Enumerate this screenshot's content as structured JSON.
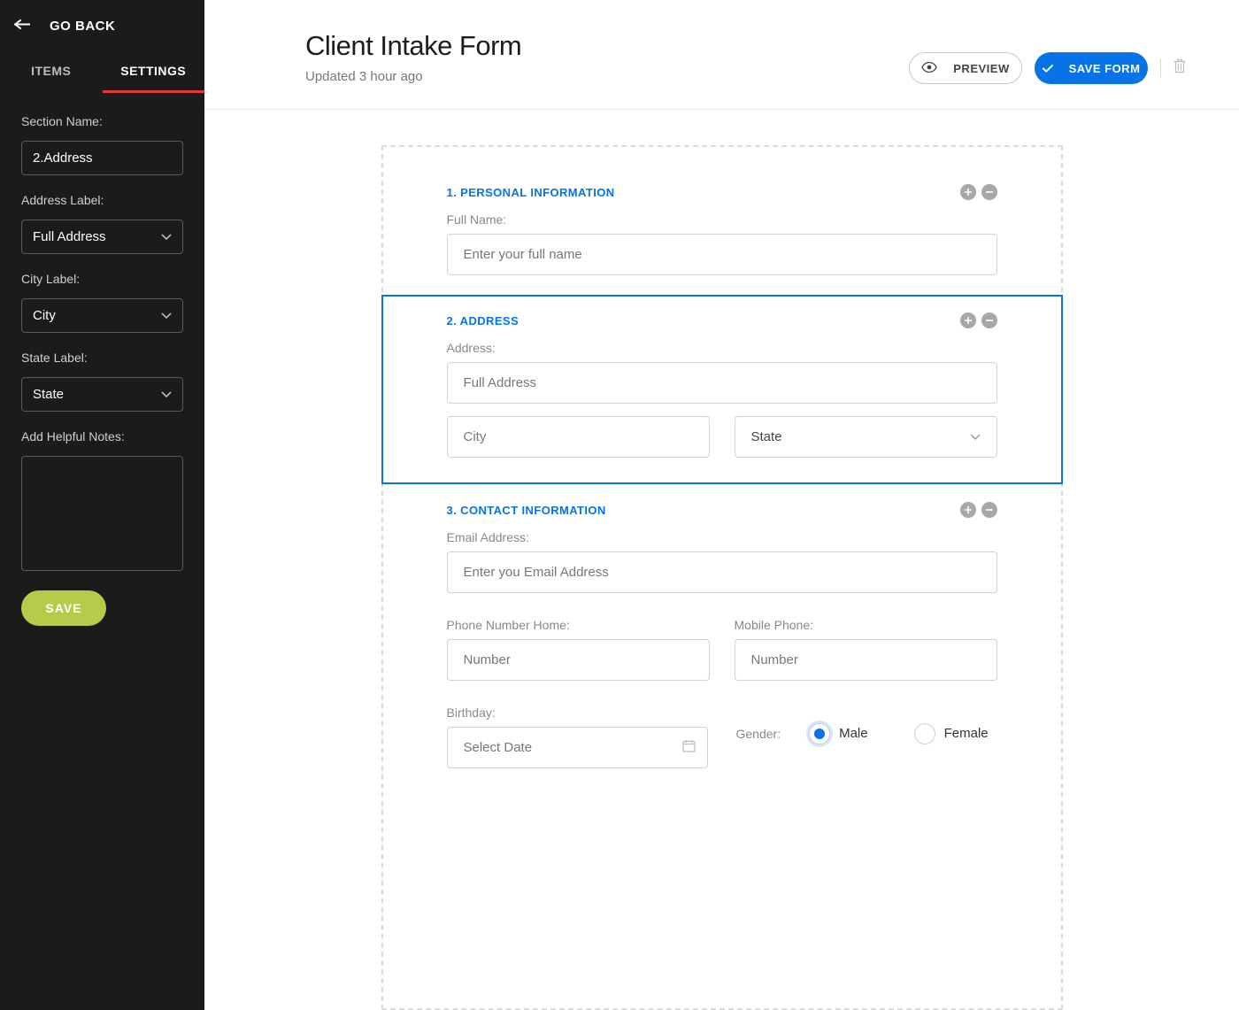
{
  "sidebar": {
    "go_back": "GO BACK",
    "tabs": {
      "items": "ITEMS",
      "settings": "SETTINGS",
      "active": "settings"
    },
    "fields": {
      "section_name_label": "Section Name:",
      "section_name_value": "2.Address",
      "address_label_label": "Address Label:",
      "address_label_value": "Full Address",
      "city_label_label": "City Label:",
      "city_label_value": "City",
      "state_label_label": "State Label:",
      "state_label_value": "State",
      "notes_label": "Add Helpful Notes:",
      "notes_value": ""
    },
    "save": "SAVE"
  },
  "header": {
    "title": "Client Intake Form",
    "subtitle": "Updated 3 hour ago",
    "preview": "PREVIEW",
    "save_form": "SAVE FORM"
  },
  "form": {
    "sections": [
      {
        "title": "1. PERSONAL INFORMATION",
        "full_name_label": "Full Name:",
        "full_name_placeholder": "Enter your full name"
      },
      {
        "title": "2. ADDRESS",
        "address_label": "Address:",
        "full_address_placeholder": "Full Address",
        "city_placeholder": "City",
        "state_placeholder": "State"
      },
      {
        "title": "3. CONTACT INFORMATION",
        "email_label": "Email Address:",
        "email_placeholder": "Enter you Email Address",
        "phone_home_label": "Phone Number Home:",
        "phone_home_placeholder": "Number",
        "mobile_label": "Mobile Phone:",
        "mobile_placeholder": "Number",
        "birthday_label": "Birthday:",
        "birthday_placeholder": "Select Date",
        "gender_label": "Gender:",
        "gender_male": "Male",
        "gender_female": "Female"
      }
    ]
  }
}
